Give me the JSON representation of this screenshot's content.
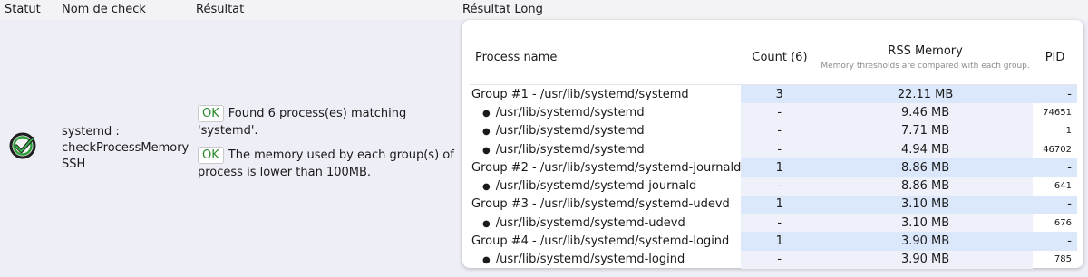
{
  "header": {
    "col_status": "Statut",
    "col_check": "Nom de check",
    "col_result": "Résultat",
    "col_long": "Résultat Long"
  },
  "check": {
    "status_icon": "ok-check-icon",
    "name_line1": "systemd :",
    "name_line2": "checkProcessMemory",
    "name_line3": "SSH"
  },
  "result": {
    "badge1": "OK",
    "msg1": "Found 6 process(es) matching 'systemd'.",
    "badge2": "OK",
    "msg2": "The memory used by each group(s) of process is lower than 100MB."
  },
  "long_result": {
    "col_process": "Process name",
    "col_count": "Count (6)",
    "col_rss": "RSS Memory",
    "col_rss_note": "Memory thresholds are compared with each group.",
    "col_pid": "PID",
    "rows": [
      {
        "name": "Group #1 - /usr/lib/systemd/systemd",
        "count": "3",
        "rss": "22.11 MB",
        "pid": "-"
      },
      {
        "name": "/usr/lib/systemd/systemd",
        "count": "-",
        "rss": "9.46 MB",
        "pid": "74651"
      },
      {
        "name": "/usr/lib/systemd/systemd",
        "count": "-",
        "rss": "7.71 MB",
        "pid": "1"
      },
      {
        "name": "/usr/lib/systemd/systemd",
        "count": "-",
        "rss": "4.94 MB",
        "pid": "46702"
      },
      {
        "name": "Group #2 - /usr/lib/systemd/systemd-journald",
        "count": "1",
        "rss": "8.86 MB",
        "pid": "-"
      },
      {
        "name": "/usr/lib/systemd/systemd-journald",
        "count": "-",
        "rss": "8.86 MB",
        "pid": "641"
      },
      {
        "name": "Group #3 - /usr/lib/systemd/systemd-udevd",
        "count": "1",
        "rss": "3.10 MB",
        "pid": "-"
      },
      {
        "name": "/usr/lib/systemd/systemd-udevd",
        "count": "-",
        "rss": "3.10 MB",
        "pid": "676"
      },
      {
        "name": "Group #4 - /usr/lib/systemd/systemd-logind",
        "count": "1",
        "rss": "3.90 MB",
        "pid": "-"
      },
      {
        "name": "/usr/lib/systemd/systemd-logind",
        "count": "-",
        "rss": "3.90 MB",
        "pid": "785"
      }
    ]
  },
  "colors": {
    "ok_green": "#2a8a2a",
    "group_highlight": "#dbe8fb",
    "row_background": "#eeeef6"
  }
}
